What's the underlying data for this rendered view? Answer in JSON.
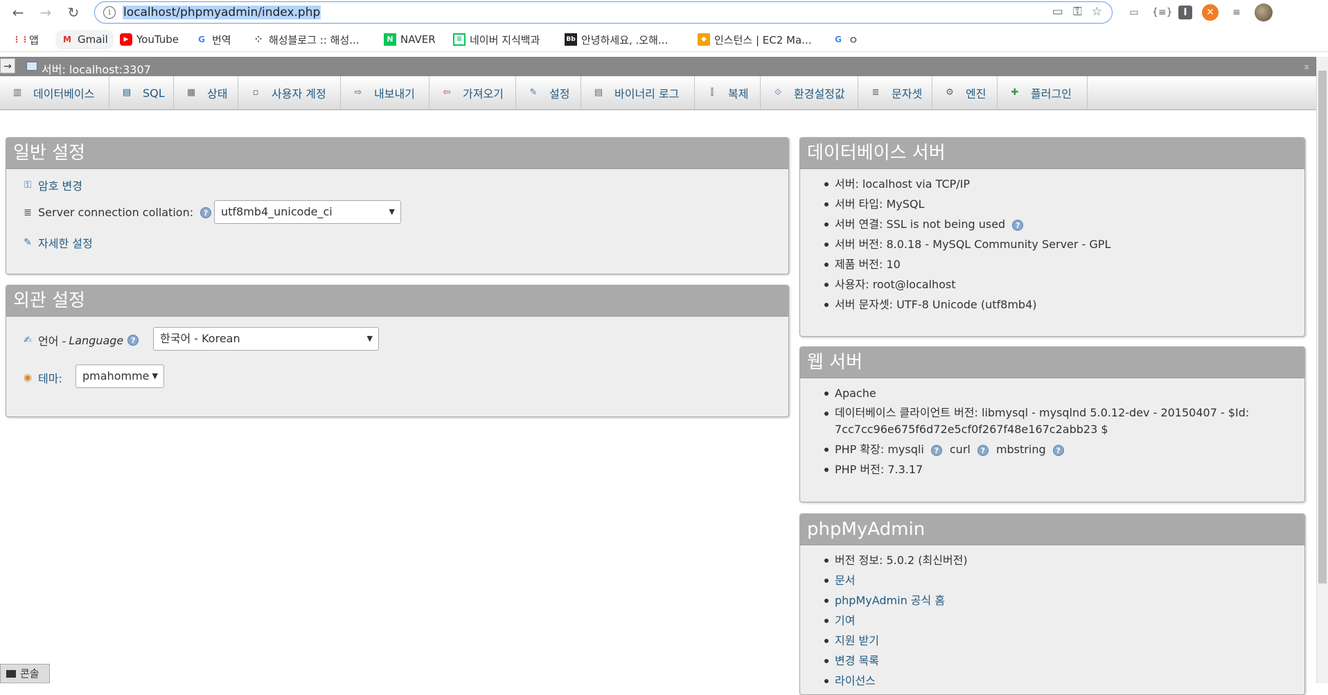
{
  "browser": {
    "url": "localhost/phpmyadmin/index.php",
    "bookmarks": [
      {
        "label": "앱",
        "icon": "apps-grid-icon"
      },
      {
        "label": "Gmail",
        "icon": "gmail-icon"
      },
      {
        "label": "YouTube",
        "icon": "youtube-icon"
      },
      {
        "label": "번역",
        "icon": "translate-icon"
      },
      {
        "label": "해성블로그 :: 해성...",
        "icon": "tistory-icon"
      },
      {
        "label": "NAVER",
        "icon": "naver-icon"
      },
      {
        "label": "네이버 지식백과",
        "icon": "naver-dict-icon"
      },
      {
        "label": "안녕하세요, .오해...",
        "icon": "blackboard-icon"
      },
      {
        "label": "인스턴스 | EC2 Ma...",
        "icon": "aws-icon"
      },
      {
        "label": "ㅇ",
        "icon": "google-icon"
      }
    ]
  },
  "server": {
    "title": "서버: localhost:3307"
  },
  "tabs": [
    {
      "label": "데이터베이스",
      "icon": "database-icon"
    },
    {
      "label": "SQL",
      "icon": "sql-icon"
    },
    {
      "label": "상태",
      "icon": "status-icon"
    },
    {
      "label": "사용자 계정",
      "icon": "user-accounts-icon"
    },
    {
      "label": "내보내기",
      "icon": "export-icon"
    },
    {
      "label": "가져오기",
      "icon": "import-icon"
    },
    {
      "label": "설정",
      "icon": "wrench-icon"
    },
    {
      "label": "바이너리 로그",
      "icon": "binary-log-icon"
    },
    {
      "label": "복제",
      "icon": "replication-icon"
    },
    {
      "label": "환경설정값",
      "icon": "variables-icon"
    },
    {
      "label": "문자셋",
      "icon": "charset-icon"
    },
    {
      "label": "엔진",
      "icon": "engine-icon"
    },
    {
      "label": "플러그인",
      "icon": "plugin-icon"
    }
  ],
  "general": {
    "title": "일반 설정",
    "change_password": "암호 변경",
    "collation_label": "Server connection collation:",
    "collation_value": "utf8mb4_unicode_ci",
    "more_settings": "자세한 설정"
  },
  "appearance": {
    "title": "외관 설정",
    "language_label": "언어 - ",
    "language_label_en": "Language",
    "language_value": "한국어 - Korean",
    "theme_label": "테마:",
    "theme_value": "pmahomme"
  },
  "db_server": {
    "title": "데이터베이스 서버",
    "items": [
      "서버: localhost via TCP/IP",
      "서버 타입: MySQL",
      "서버 연결: SSL is not being used",
      "서버 버전: 8.0.18 - MySQL Community Server - GPL",
      "제품 버전: 10",
      "사용자: root@localhost",
      "서버 문자셋: UTF-8 Unicode (utf8mb4)"
    ]
  },
  "web_server": {
    "title": "웹 서버",
    "items": [
      "Apache",
      "데이터베이스 클라이언트 버전: libmysql - mysqlnd 5.0.12-dev - 20150407 - $Id:",
      "7cc7cc96e675f6d72e5cf0f267f48e167c2abb23 $",
      "PHP 확장: mysqli",
      "curl",
      "mbstring",
      "PHP 버전: 7.3.17"
    ]
  },
  "pma": {
    "title": "phpMyAdmin",
    "items": [
      "버전 정보: 5.0.2 (최신버전)",
      "문서",
      "phpMyAdmin 공식 홈",
      "기여",
      "지원 받기",
      "변경 목록",
      "라이선스"
    ]
  },
  "console": {
    "label": "콘솔"
  }
}
